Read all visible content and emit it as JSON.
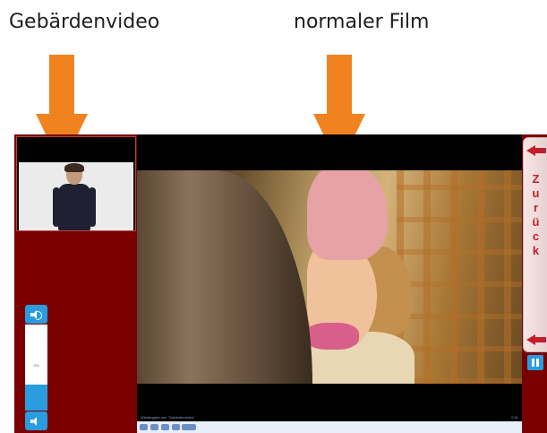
{
  "captions": {
    "left": "Gebärdenvideo",
    "right": "normaler Film"
  },
  "back_button": {
    "letters": [
      "Z",
      "u",
      "r",
      "ü",
      "c",
      "k"
    ]
  },
  "volume": {
    "value_label": "0%",
    "level": 0.3
  },
  "video_status": {
    "left": "Wiedergabe von \"Gebärdenvideo\"",
    "right": "0:31"
  },
  "colors": {
    "arrow": "#f0831f",
    "panel": "#7a0000",
    "button_blue": "#2a9ce0",
    "back_red": "#c21f2b"
  }
}
